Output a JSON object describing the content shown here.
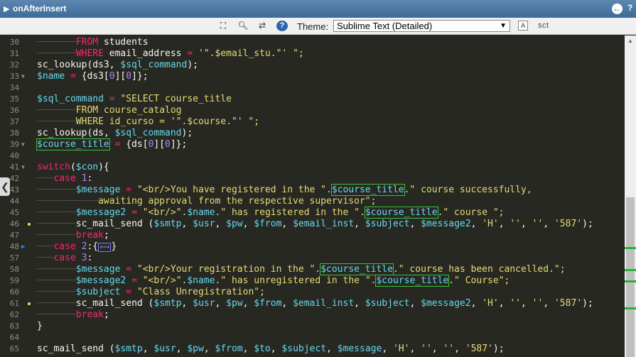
{
  "window": {
    "title": "onAfterInsert"
  },
  "toolbar": {
    "theme_label": "Theme:",
    "theme_value": "Sublime Text (Detailed)",
    "font_button": "A",
    "sct_text": "sct"
  },
  "colors": {
    "accent": "#3e6a98",
    "editor_bg": "#272822",
    "match_outline": "#3ac43a"
  },
  "editor": {
    "lines": [
      {
        "n": "30",
        "code": "<span class='guide'>───────</span><span class='kw'>FROM</span> students"
      },
      {
        "n": "31",
        "code": "<span class='guide'>───────</span><span class='kw'>WHERE</span> email_address <span class='op'>=</span> <span class='str'>'\".$email_stu.\"'</span> <span class='str'>\";</span>"
      },
      {
        "n": "32",
        "code": "sc_lookup(ds3, <span class='var'>$sql_command</span>);"
      },
      {
        "n": "33",
        "fold": "▼",
        "code": "<span class='var'>$name</span> <span class='op'>=</span> {ds3[<span class='num'>0</span>][<span class='num'>0</span>]};"
      },
      {
        "n": "34",
        "code": ""
      },
      {
        "n": "35",
        "code": "<span class='var'>$sql_command</span> <span class='op'>=</span> <span class='str'>\"SELECT course_title</span>"
      },
      {
        "n": "36",
        "code": "<span class='guide'>───────</span><span class='str'>FROM course_catalog</span>"
      },
      {
        "n": "37",
        "code": "<span class='guide'>───────</span><span class='str'>WHERE id_curso = '\".$course.\"' \";</span>"
      },
      {
        "n": "38",
        "code": "sc_lookup(ds, <span class='var'>$sql_command</span>);"
      },
      {
        "n": "39",
        "fold": "▼",
        "code": "<span class='var hl'>$course_title</span> <span class='op'>=</span> {ds[<span class='num'>0</span>][<span class='num'>0</span>]};"
      },
      {
        "n": "40",
        "code": ""
      },
      {
        "n": "41",
        "fold": "▼",
        "code": "<span class='kw'>switch</span>(<span class='var'>$con</span>){"
      },
      {
        "n": "42",
        "code": "<span class='guide'>───</span><span class='kw'>case</span> <span class='num'>1</span>:"
      },
      {
        "n": "43",
        "code": "<span class='guide'>───────</span><span class='var'>$message</span> <span class='op'>=</span> <span class='str'>\"&lt;br/&gt;You have registered in the \".</span><span class='var hl'>$course_title</span><span class='str'>.\" course successfully,</span>"
      },
      {
        "n": "44",
        "code": "<span class='guide'>───────────</span><span class='str'>awaiting approval from the respective supervisor\";</span>"
      },
      {
        "n": "45",
        "code": "<span class='guide'>───────</span><span class='var'>$message2</span> <span class='op'>=</span> <span class='str'>\"&lt;br/&gt;\".</span><span class='var'>$name</span><span class='str'>.\" has registered in the \".</span><span class='var hl'>$course_title</span><span class='str'>.\" course \";</span>"
      },
      {
        "n": "46",
        "bp": true,
        "code": "<span class='guide'>───────</span>sc_mail_send (<span class='var'>$smtp</span>, <span class='var'>$usr</span>, <span class='var'>$pw</span>, <span class='var'>$from</span>, <span class='var'>$email_inst</span>, <span class='var'>$subject</span>, <span class='var'>$message2</span>, <span class='str'>'H'</span>, <span class='str'>''</span>, <span class='str'>''</span>, <span class='str'>'587'</span>);"
      },
      {
        "n": "47",
        "code": "<span class='guide'>───────</span><span class='kw'>break</span>;"
      },
      {
        "n": "48",
        "arrow": true,
        "code": "<span class='guide'>───</span><span class='kw'>case</span> <span class='num'>2</span>:{<span class='foldbox'>⟺</span>}"
      },
      {
        "n": "57",
        "code": "<span class='guide'>───</span><span class='kw'>case</span> <span class='num'>3</span>:"
      },
      {
        "n": "58",
        "code": "<span class='guide'>───────</span><span class='var'>$message</span> <span class='op'>=</span> <span class='str'>\"&lt;br/&gt;Your registration in the \".</span><span class='var hl'>$course_title</span><span class='str'>.\" course has been cancelled.\";</span>"
      },
      {
        "n": "59",
        "code": "<span class='guide'>───────</span><span class='var'>$message2</span> <span class='op'>=</span> <span class='str'>\"&lt;br/&gt;\".</span><span class='var'>$name</span><span class='str'>.\" has unregistered in the \".</span><span class='var hl'>$course_title</span><span class='str'>.\" Course\";</span>"
      },
      {
        "n": "60",
        "code": "<span class='guide'>───────</span><span class='var'>$subject</span> <span class='op'>=</span> <span class='str'>\"Class Unregistration\";</span>"
      },
      {
        "n": "61",
        "bp": true,
        "code": "<span class='guide'>───────</span>sc_mail_send (<span class='var'>$smtp</span>, <span class='var'>$usr</span>, <span class='var'>$pw</span>, <span class='var'>$from</span>, <span class='var'>$email_inst</span>, <span class='var'>$subject</span>, <span class='var'>$message2</span>, <span class='str'>'H'</span>, <span class='str'>''</span>, <span class='str'>''</span>, <span class='str'>'587'</span>);"
      },
      {
        "n": "62",
        "code": "<span class='guide'>───────</span><span class='kw'>break</span>;"
      },
      {
        "n": "63",
        "code": "}"
      },
      {
        "n": "64",
        "code": ""
      },
      {
        "n": "65",
        "code": "sc_mail_send (<span class='var'>$smtp</span>, <span class='var'>$usr</span>, <span class='var'>$pw</span>, <span class='var'>$from</span>, <span class='var'>$to</span>, <span class='var'>$subject</span>, <span class='var'>$message</span>, <span class='str'>'H'</span>, <span class='str'>''</span>, <span class='str'>''</span>, <span class='str'>'587'</span>);"
      }
    ]
  },
  "icons": [
    "expand-icon",
    "search-icon",
    "replace-icon",
    "help-icon",
    "back-icon",
    "collapse-arrow-icon"
  ]
}
